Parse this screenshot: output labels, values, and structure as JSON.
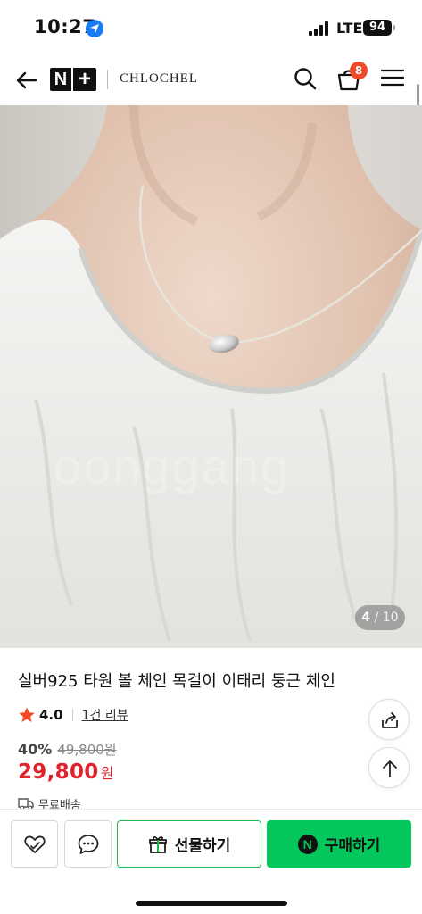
{
  "status_bar": {
    "time": "10:27",
    "network": "LTE",
    "battery": "94"
  },
  "header": {
    "logo_n": "N",
    "logo_plus": "+",
    "brand": "CHLOCHEL",
    "cart_count": "8",
    "icons": [
      "back-arrow-icon",
      "search-icon",
      "cart-icon",
      "menu-icon"
    ]
  },
  "gallery": {
    "current": "4",
    "separator": "/",
    "total": "10",
    "watermark": "oonggang"
  },
  "product": {
    "title": "실버925 타원 볼 체인 목걸이 이태리 둥근 체인",
    "rating": "4.0",
    "review_link": "1건 리뷰",
    "discount": "40%",
    "original_price": "49,800원",
    "sale_price": "29,800",
    "currency": "원",
    "shipping": "무료배송"
  },
  "bottom_bar": {
    "gift_label": "선물하기",
    "buy_label": "구매하기",
    "npay_letter": "N",
    "accent_color": "#03c75a"
  },
  "colors": {
    "price_red": "#e0222d",
    "badge": "#ef4a2a",
    "star": "#f2492b"
  }
}
